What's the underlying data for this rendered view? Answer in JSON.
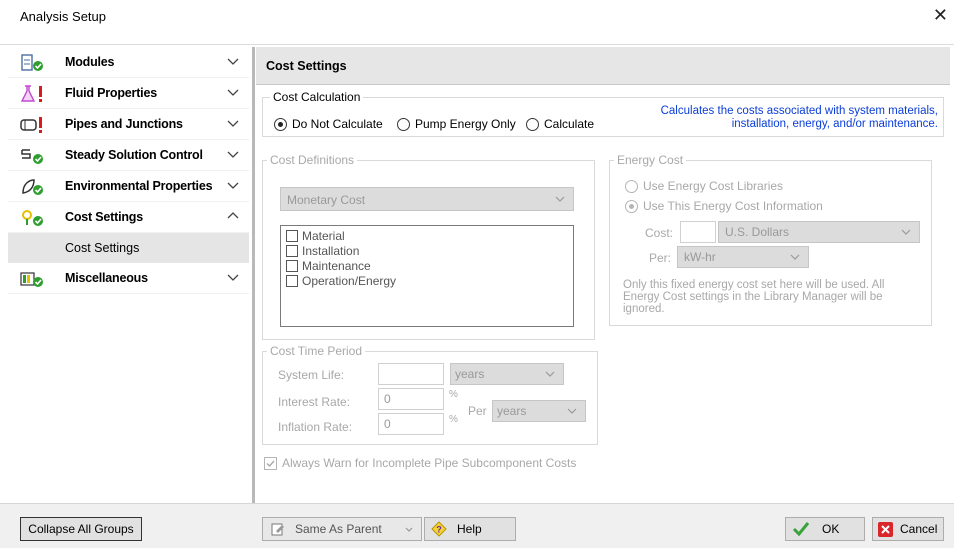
{
  "window": {
    "title": "Analysis Setup",
    "close_glyph": "✕"
  },
  "sidebar": {
    "groups": [
      {
        "label": "Modules",
        "icon": "modules-icon"
      },
      {
        "label": "Fluid Properties",
        "icon": "fluid-properties-icon"
      },
      {
        "label": "Pipes and Junctions",
        "icon": "pipes-junctions-icon"
      },
      {
        "label": "Steady Solution Control",
        "icon": "steady-solution-icon"
      },
      {
        "label": "Environmental Properties",
        "icon": "environmental-icon"
      },
      {
        "label": "Cost Settings",
        "icon": "cost-settings-icon"
      },
      {
        "label": "Miscellaneous",
        "icon": "miscellaneous-icon"
      }
    ],
    "subitems": [
      {
        "label": "Cost Settings"
      }
    ],
    "colors": {
      "check_green": "#2e9e2e",
      "warn_red": "#d81b1b",
      "purple_flask": "#c24ad1",
      "yellow": "#e6c000"
    }
  },
  "main": {
    "header": "Cost Settings",
    "cost_calculation": {
      "legend": "Cost Calculation",
      "options": [
        "Do Not Calculate",
        "Pump Energy Only",
        "Calculate"
      ],
      "selected": "Do Not Calculate",
      "description": "Calculates the costs associated with system materials, installation, energy, and/or maintenance."
    },
    "cost_definitions": {
      "legend": "Cost Definitions",
      "dropdown_value": "Monetary Cost",
      "items": [
        "Material",
        "Installation",
        "Maintenance",
        "Operation/Energy"
      ]
    },
    "energy_cost": {
      "legend": "Energy Cost",
      "options": [
        "Use Energy Cost Libraries",
        "Use This Energy Cost Information"
      ],
      "selected": "Use This Energy Cost Information",
      "cost_label": "Cost:",
      "cost_value": "",
      "currency": "U.S. Dollars",
      "per_label": "Per:",
      "per_value": "kW-hr",
      "note": "Only this fixed energy cost set here will be used. All Energy Cost settings in the Library Manager will be ignored."
    },
    "cost_time_period": {
      "legend": "Cost Time Period",
      "system_life_label": "System Life:",
      "system_life_value": "",
      "system_life_unit": "years",
      "interest_rate_label": "Interest Rate:",
      "interest_rate_value": "0",
      "inflation_rate_label": "Inflation Rate:",
      "inflation_rate_value": "0",
      "percent_symbol": "%",
      "per_label": "Per",
      "per_unit": "years"
    },
    "always_warn": {
      "label": "Always Warn for Incomplete Pipe Subcomponent Costs",
      "checked": true
    }
  },
  "footer": {
    "collapse_all": "Collapse All Groups",
    "same_as_parent": "Same As Parent",
    "help": "Help",
    "ok": "OK",
    "cancel": "Cancel"
  }
}
